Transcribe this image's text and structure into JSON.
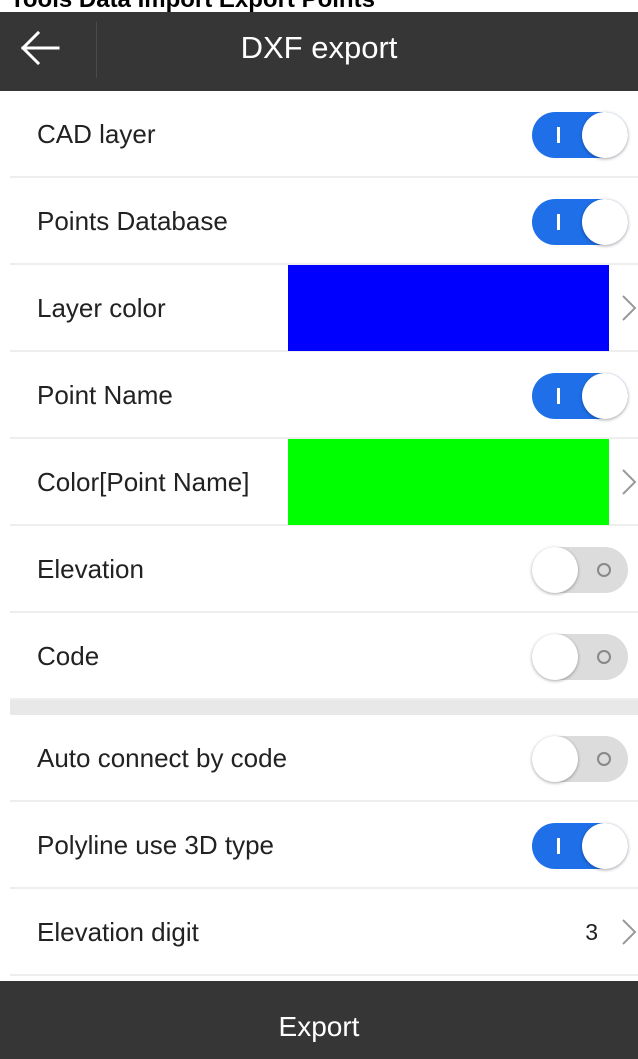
{
  "top_strip": {
    "text": "Tools Data Import Export Points"
  },
  "header": {
    "title": "DXF export"
  },
  "settings": {
    "cad_layer": {
      "label": "CAD layer",
      "state": "on"
    },
    "points_database": {
      "label": "Points Database",
      "state": "on"
    },
    "layer_color": {
      "label": "Layer color",
      "color": "#0000ff"
    },
    "point_name": {
      "label": "Point Name",
      "state": "on"
    },
    "point_name_color": {
      "label": "Color[Point Name]",
      "color": "#00ff00"
    },
    "elevation": {
      "label": "Elevation",
      "state": "off"
    },
    "code": {
      "label": "Code",
      "state": "off"
    },
    "auto_connect": {
      "label": "Auto connect by code",
      "state": "off"
    },
    "polyline_3d": {
      "label": "Polyline use 3D type",
      "state": "on"
    },
    "elevation_digit": {
      "label": "Elevation digit",
      "value": "3"
    }
  },
  "footer": {
    "export_label": "Export"
  },
  "colors": {
    "header_bg": "#363636",
    "toggle_on": "#1e6fe8",
    "toggle_off": "#dcdcdc"
  }
}
